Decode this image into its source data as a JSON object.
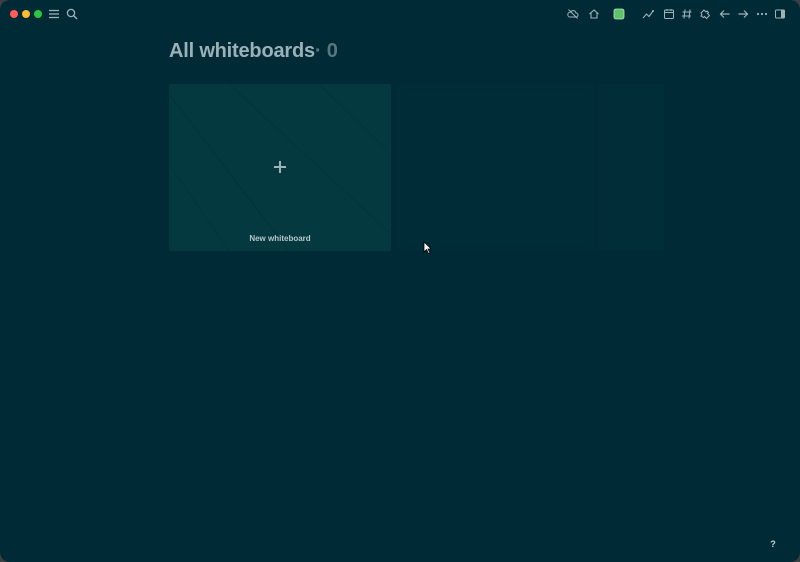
{
  "toolbar": {
    "left_icons": [
      "menu-icon",
      "search-icon"
    ],
    "right_icons": [
      "cloud-off-icon",
      "home-icon",
      "green-square-icon",
      "graph-icon",
      "calendar-icon",
      "hashtag-icon",
      "puzzle-icon",
      "back-arrow-icon",
      "forward-arrow-icon",
      "more-icon",
      "sidebar-toggle-icon"
    ]
  },
  "page": {
    "title": "All whiteboards",
    "separator": "·",
    "count": "0"
  },
  "new_whiteboard": {
    "label": "New whiteboard"
  },
  "help": {
    "label": "?"
  },
  "colors": {
    "background": "#002a35",
    "card": "#03393f",
    "title": "#9cb0b7",
    "accent_green": "#5ec26a"
  }
}
